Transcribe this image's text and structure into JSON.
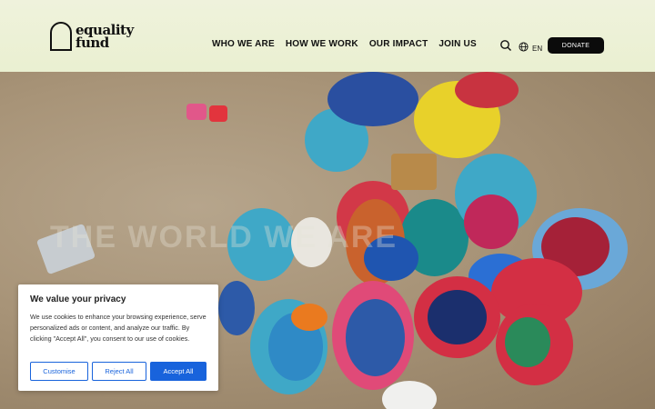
{
  "header": {
    "logo_text": "equality fund",
    "nav": [
      "WHO WE ARE",
      "HOW WE WORK",
      "OUR IMPACT",
      "JOIN US"
    ],
    "search_icon": "search-icon",
    "language": "EN",
    "language_icon": "globe-icon",
    "donate_label": "DONATE"
  },
  "hero": {
    "overlay_text": "THE WORLD WE ARE"
  },
  "cookie": {
    "title": "We value your privacy",
    "body": "We use cookies to enhance your browsing experience, serve personalized ads or content, and analyze our traffic. By clicking \"Accept All\", you consent to our use of cookies.",
    "buttons": {
      "customise": "Customise",
      "reject": "Reject All",
      "accept": "Accept All"
    },
    "accent": "#1863dc"
  }
}
